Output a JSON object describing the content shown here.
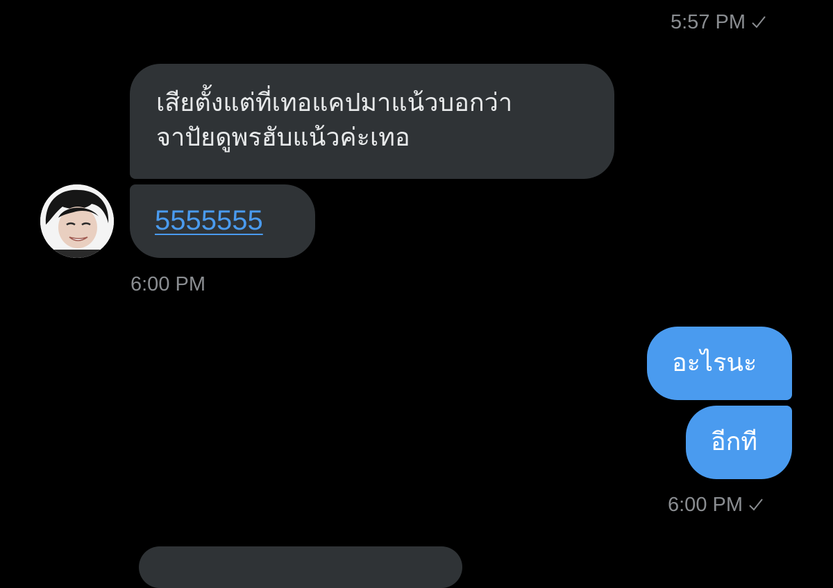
{
  "top_status": {
    "time": "5:57 PM",
    "read_icon": "checkmark-icon"
  },
  "received_group": {
    "messages": [
      {
        "line1": "เสียตั้งแต่ที่เทอแคปมาแน้วบอกว่า",
        "line2": "จาปัยดูพรฮับแน้วค่ะเทอ"
      },
      {
        "link_text": "5555555"
      }
    ],
    "time": "6:00 PM",
    "avatar_icon": "user-avatar"
  },
  "sent_group": {
    "messages": [
      {
        "text": "อะไรนะ"
      },
      {
        "text": "อีกที"
      }
    ],
    "time": "6:00 PM",
    "read_icon": "checkmark-icon"
  },
  "colors": {
    "background": "#000000",
    "received_bubble": "#2f3336",
    "sent_bubble": "#4a9bef",
    "link": "#4a9bef",
    "timestamp": "#8a8d91"
  }
}
